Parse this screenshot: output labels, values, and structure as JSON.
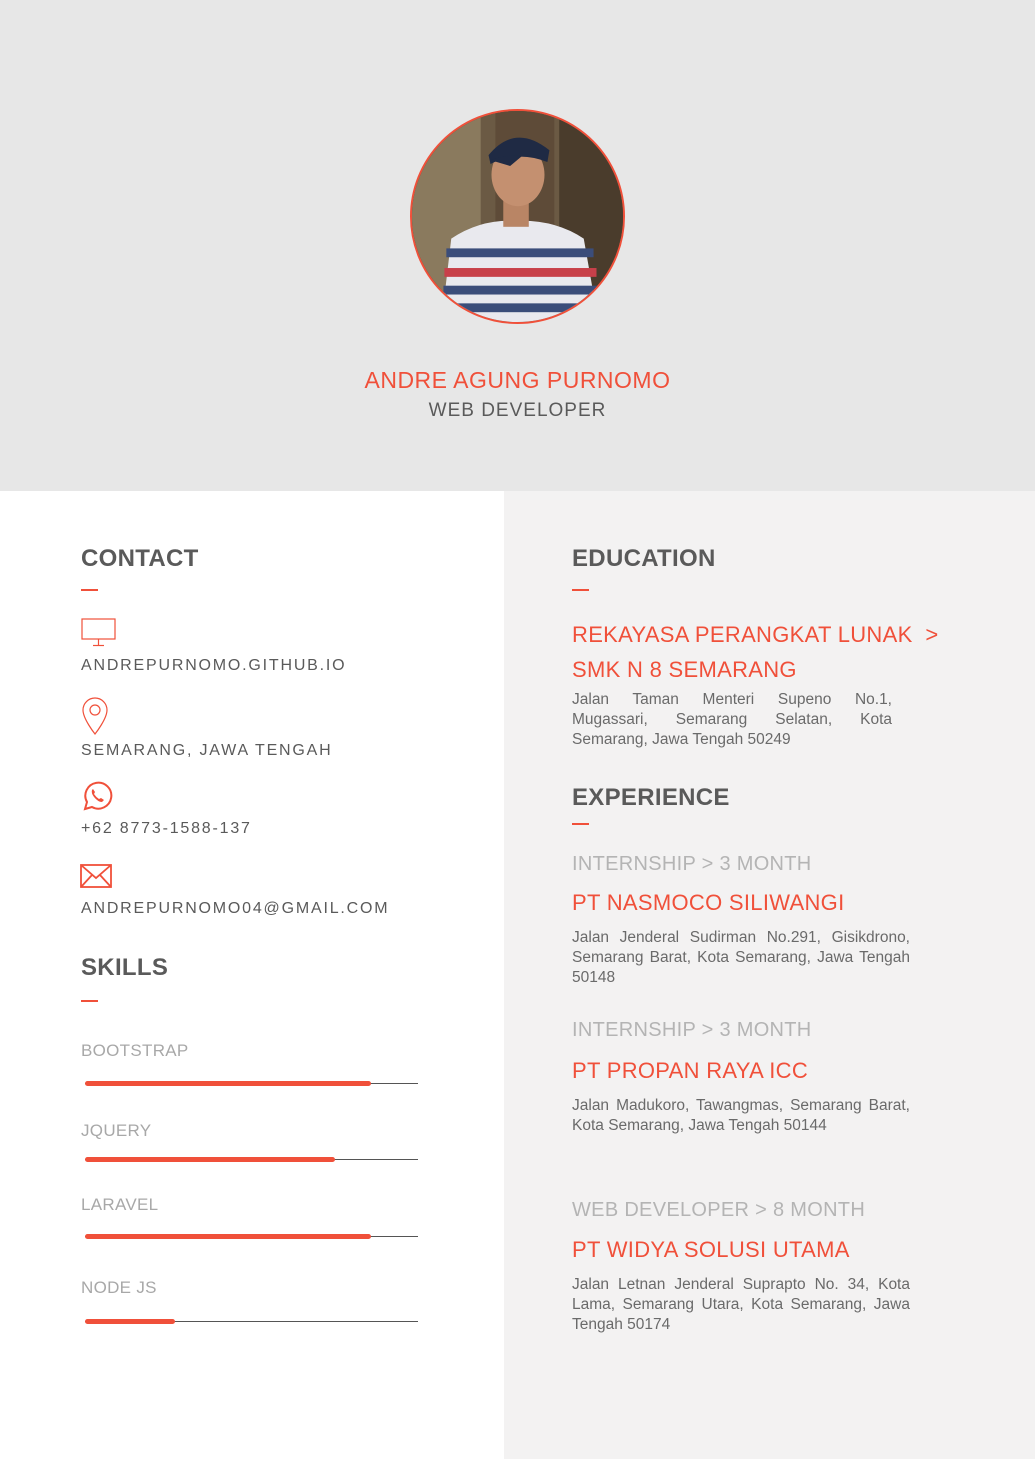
{
  "profile": {
    "name": "ANDRE AGUNG PURNOMO",
    "role": "WEB DEVELOPER"
  },
  "colors": {
    "accent": "#f0503a",
    "header_bg": "#e7e7e7",
    "panel_bg": "#f3f2f2",
    "heading": "#5a5a5a"
  },
  "contact": {
    "title": "CONTACT",
    "items": [
      {
        "icon": "monitor-icon",
        "text": "ANDREPURNOMO.GITHUB.IO"
      },
      {
        "icon": "location-pin-icon",
        "text": "SEMARANG, JAWA TENGAH"
      },
      {
        "icon": "whatsapp-icon",
        "text": "+62 8773-1588-137"
      },
      {
        "icon": "envelope-icon",
        "text": "ANDREPURNOMO04@GMAIL.COM"
      }
    ]
  },
  "skills": {
    "title": "SKILLS",
    "items": [
      {
        "label": "BOOTSTRAP",
        "level": 0.86
      },
      {
        "label": "JQUERY",
        "level": 0.75
      },
      {
        "label": "LARAVEL",
        "level": 0.86
      },
      {
        "label": "NODE JS",
        "level": 0.27
      }
    ]
  },
  "education": {
    "title": "EDUCATION",
    "line1": "REKAYASA PERANGKAT LUNAK  >",
    "line2": "SMK N 8 SEMARANG",
    "address": "Jalan Taman Menteri Supeno No.1, Mugassari, Semarang Selatan, Kota Semarang, Jawa Tengah 50249"
  },
  "experience": {
    "title": "EXPERIENCE",
    "items": [
      {
        "meta": "INTERNSHIP > 3 MONTH",
        "company": "PT NASMOCO SILIWANGI",
        "address": "Jalan Jenderal Sudirman No.291, Gisikdrono, Semarang Barat, Kota Semarang, Jawa Tengah 50148"
      },
      {
        "meta": "INTERNSHIP > 3 MONTH",
        "company": "PT PROPAN RAYA ICC",
        "address": "Jalan Madukoro, Tawangmas, Semarang Barat, Kota Semarang, Jawa Tengah 50144"
      },
      {
        "meta": "WEB DEVELOPER > 8 MONTH",
        "company": "PT WIDYA SOLUSI UTAMA",
        "address": "Jalan Letnan Jenderal Suprapto No. 34, Kota Lama, Semarang Utara, Kota Semarang, Jawa Tengah 50174"
      }
    ]
  }
}
